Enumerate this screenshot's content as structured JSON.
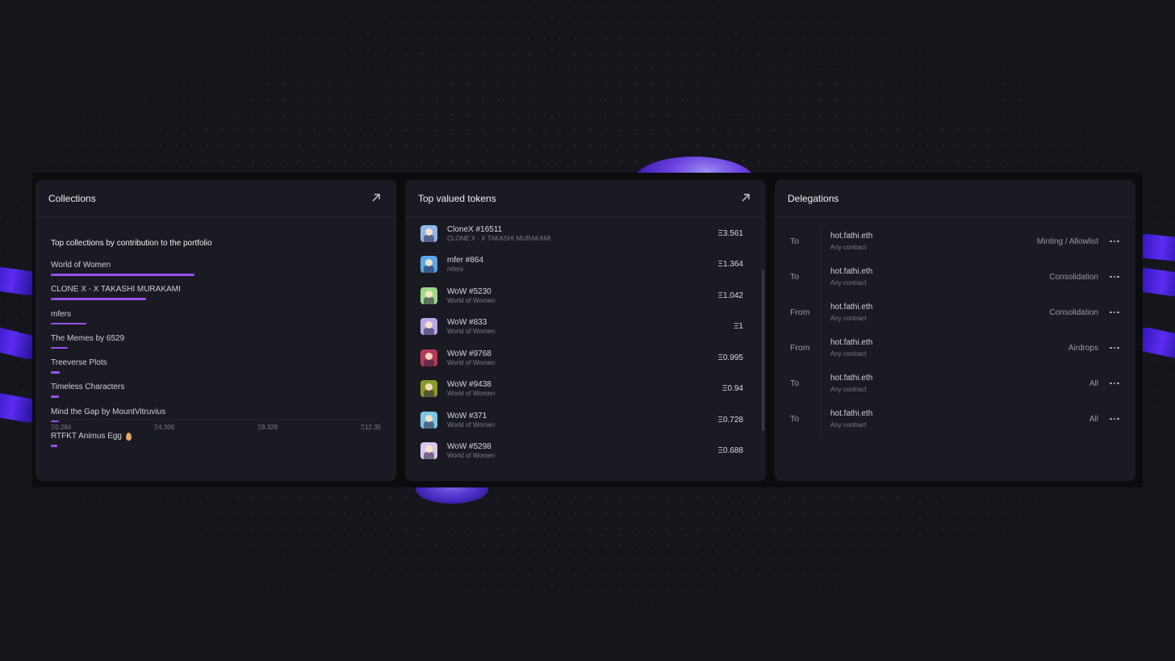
{
  "collections": {
    "title": "Collections",
    "subtitle": "Top collections by contribution to the portfolio",
    "items": [
      {
        "label": "World of Women",
        "fraction": 0.435
      },
      {
        "label": "CLONE X - X TAKASHI MURAKAMI",
        "fraction": 0.288
      },
      {
        "label": "mfers",
        "fraction": 0.108
      },
      {
        "label": "The Memes by 6529",
        "fraction": 0.052
      },
      {
        "label": "Treeverse Plots",
        "fraction": 0.027
      },
      {
        "label": "Timeless Characters",
        "fraction": 0.025
      },
      {
        "label": "Mind the Gap by MountVitruvius",
        "fraction": 0.024
      },
      {
        "label": "RTFKT Animus Egg",
        "fraction": 0.02,
        "icon": "egg-icon"
      }
    ],
    "axis_ticks": [
      "Ξ0.284",
      "Ξ4.306",
      "Ξ8.329",
      "Ξ12.35"
    ]
  },
  "tokens": {
    "title": "Top valued tokens",
    "items": [
      {
        "name": "CloneX #16511",
        "collection": "CLONE X - X TAKASHI MURAKAMI",
        "value": "Ξ3.561",
        "color": "#8fb6e6"
      },
      {
        "name": "mfer #864",
        "collection": "mfers",
        "value": "Ξ1.364",
        "color": "#5aa8e8"
      },
      {
        "name": "WoW #5230",
        "collection": "World of Women",
        "value": "Ξ1.042",
        "color": "#9ed88a"
      },
      {
        "name": "WoW #833",
        "collection": "World of Women",
        "value": "Ξ1",
        "color": "#b6a8e8"
      },
      {
        "name": "WoW #9768",
        "collection": "World of Women",
        "value": "Ξ0.995",
        "color": "#b83a5a"
      },
      {
        "name": "WoW #9438",
        "collection": "World of Women",
        "value": "Ξ0.94",
        "color": "#8a9a2a"
      },
      {
        "name": "WoW #371",
        "collection": "World of Women",
        "value": "Ξ0.728",
        "color": "#7ac6e8"
      },
      {
        "name": "WoW #5298",
        "collection": "World of Women",
        "value": "Ξ0.688",
        "color": "#d8c6ea"
      }
    ]
  },
  "delegations": {
    "title": "Delegations",
    "items": [
      {
        "direction": "To",
        "address": "hot.fathi.eth",
        "contract": "Any contract",
        "type": "Minting / Allowlist"
      },
      {
        "direction": "To",
        "address": "hot.fathi.eth",
        "contract": "Any contract",
        "type": "Consolidation"
      },
      {
        "direction": "From",
        "address": "hot.fathi.eth",
        "contract": "Any contract",
        "type": "Consolidation"
      },
      {
        "direction": "From",
        "address": "hot.fathi.eth",
        "contract": "Any contract",
        "type": "Airdrops"
      },
      {
        "direction": "To",
        "address": "hot.fathi.eth",
        "contract": "Any contract",
        "type": "All"
      },
      {
        "direction": "To",
        "address": "hot.fathi.eth",
        "contract": "Any contract",
        "type": "All"
      }
    ]
  },
  "colors": {
    "accent": "#9a4ff0",
    "card": "#1a1a22",
    "background": "#15151c"
  }
}
